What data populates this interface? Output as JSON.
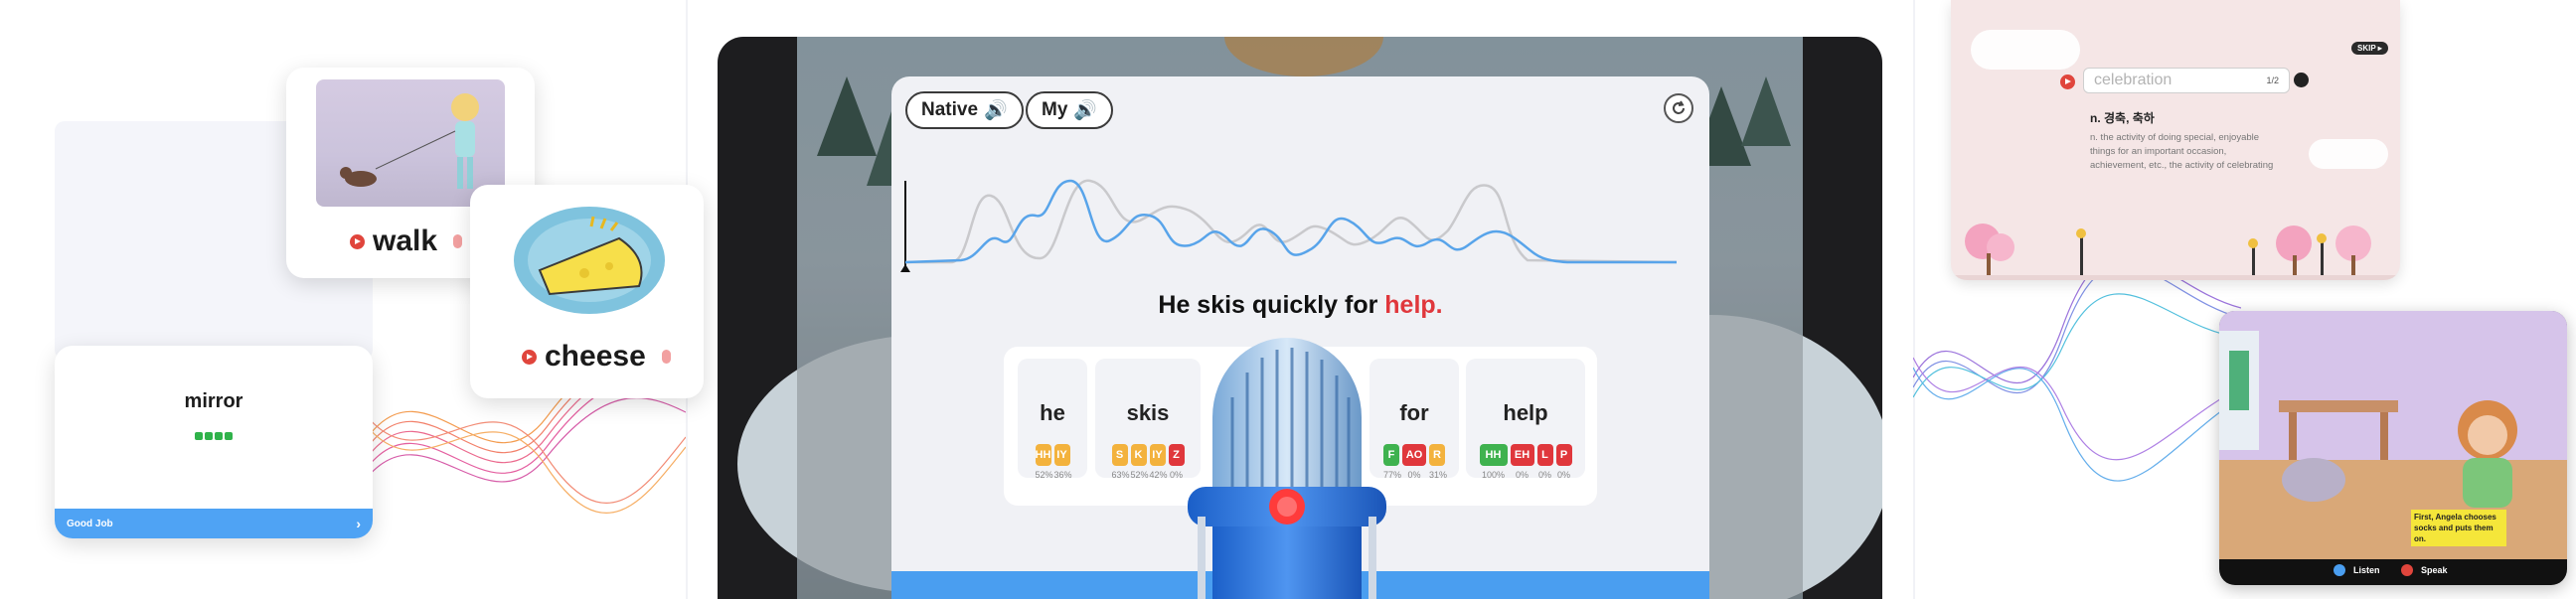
{
  "left": {
    "cards": [
      {
        "word": "walk"
      },
      {
        "word": "cheese"
      }
    ],
    "mirror_card": {
      "title": "mirror",
      "footer_label": "Good Job",
      "footer_arrow": "›"
    }
  },
  "center": {
    "native_label": "Native",
    "my_label": "My",
    "sentence_prefix": "He skis quickly for ",
    "sentence_highlight": "help.",
    "words": [
      {
        "text": "he",
        "phonemes": [
          {
            "p": "HH",
            "pct": "52%",
            "c": "#f3b23d"
          },
          {
            "p": "IY",
            "pct": "36%",
            "c": "#f3b23d"
          }
        ]
      },
      {
        "text": "skis",
        "phonemes": [
          {
            "p": "S",
            "pct": "63%",
            "c": "#f3b23d"
          },
          {
            "p": "K",
            "pct": "52%",
            "c": "#f3b23d"
          },
          {
            "p": "IY",
            "pct": "42%",
            "c": "#f3b23d"
          },
          {
            "p": "Z",
            "pct": "0%",
            "c": "#e0373c"
          }
        ]
      },
      {
        "text": "for",
        "phonemes": [
          {
            "p": "F",
            "pct": "77%",
            "c": "#3fb24f"
          },
          {
            "p": "AO",
            "pct": "0%",
            "c": "#e0373c"
          },
          {
            "p": "R",
            "pct": "31%",
            "c": "#f3b23d"
          }
        ]
      },
      {
        "text": "help",
        "phonemes": [
          {
            "p": "HH",
            "pct": "100%",
            "c": "#3fb24f"
          },
          {
            "p": "EH",
            "pct": "0%",
            "c": "#e0373c"
          },
          {
            "p": "L",
            "pct": "0%",
            "c": "#e0373c"
          },
          {
            "p": "P",
            "pct": "0%",
            "c": "#e0373c"
          }
        ]
      }
    ]
  },
  "right": {
    "skip_label": "SKIP ▸",
    "search_value": "celebration",
    "search_count": "1/2",
    "definition_title": "n. 경축, 축하",
    "definition_text": "n. the activity of doing special, enjoyable things for an important occasion, achievement, etc., the activity of celebrating",
    "story_caption": "First, Angela chooses socks and puts them on.",
    "listen_label": "Listen",
    "speak_label": "Speak"
  },
  "colors": {
    "accent_blue": "#4a9ef0",
    "red": "#e0373c",
    "yellow": "#f3b23d",
    "green": "#3fb24f"
  }
}
